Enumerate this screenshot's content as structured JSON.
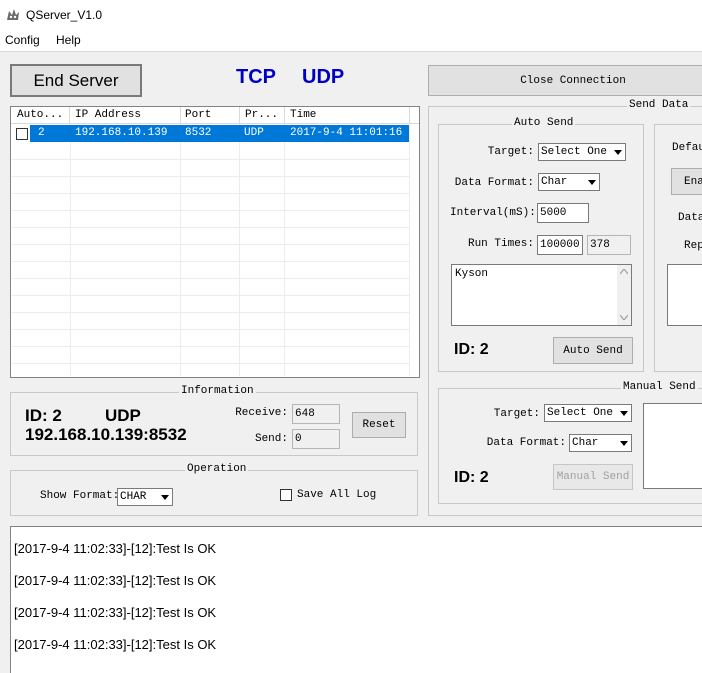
{
  "window": {
    "title": "QServer_V1.0"
  },
  "menu": {
    "config": "Config",
    "help": "Help"
  },
  "toolbar": {
    "end_server": "End Server",
    "tcp": "TCP",
    "udp": "UDP",
    "close_connection": "Close Connection"
  },
  "clients": {
    "columns": [
      "Auto...",
      "IP Address",
      "Port",
      "Pr...",
      "Time"
    ],
    "rows": [
      {
        "id": "2",
        "ip": "192.168.10.139",
        "port": "8532",
        "protocol": "UDP",
        "time": "2017-9-4 11:01:16",
        "checked": false
      }
    ]
  },
  "information": {
    "legend": "Information",
    "id_label": "ID: 2",
    "protocol": "UDP",
    "address": "192.168.10.139:8532",
    "receive_label": "Receive:",
    "receive_value": "648",
    "send_label": "Send:",
    "send_value": "0",
    "reset": "Reset"
  },
  "operation": {
    "legend": "Operation",
    "show_format_label": "Show Format:",
    "show_format_value": "CHAR",
    "save_all_log": "Save All Log"
  },
  "send_data": {
    "legend": "Send Data",
    "auto_send": {
      "legend": "Auto Send",
      "target_label": "Target:",
      "target_value": "Select One",
      "format_label": "Data Format:",
      "format_value": "Char",
      "interval_label": "Interval(mS):",
      "interval_value": "5000",
      "run_times_label": "Run Times:",
      "run_times_value": "100000",
      "run_times_count": "378",
      "text": "Kyson",
      "id_label": "ID: 2",
      "button": "Auto Send"
    },
    "right_partial": {
      "default_label": "Defau",
      "enable_button": "Ena",
      "data_label": "Data",
      "repeat_label": "Rep"
    },
    "manual_send": {
      "legend": "Manual Send",
      "target_label": "Target:",
      "target_value": "Select One",
      "format_label": "Data Format:",
      "format_value": "Char",
      "id_label": "ID: 2",
      "button": "Manual Send"
    }
  },
  "log": {
    "lines": [
      "[2017-9-4 11:02:33]-[12]:Test Is OK",
      "[2017-9-4 11:02:33]-[12]:Test Is OK",
      "[2017-9-4 11:02:33]-[12]:Test Is OK",
      "[2017-9-4 11:02:33]-[12]:Test Is OK"
    ]
  },
  "colors": {
    "accent_text": "#0000c0",
    "selection": "#0078d7"
  }
}
